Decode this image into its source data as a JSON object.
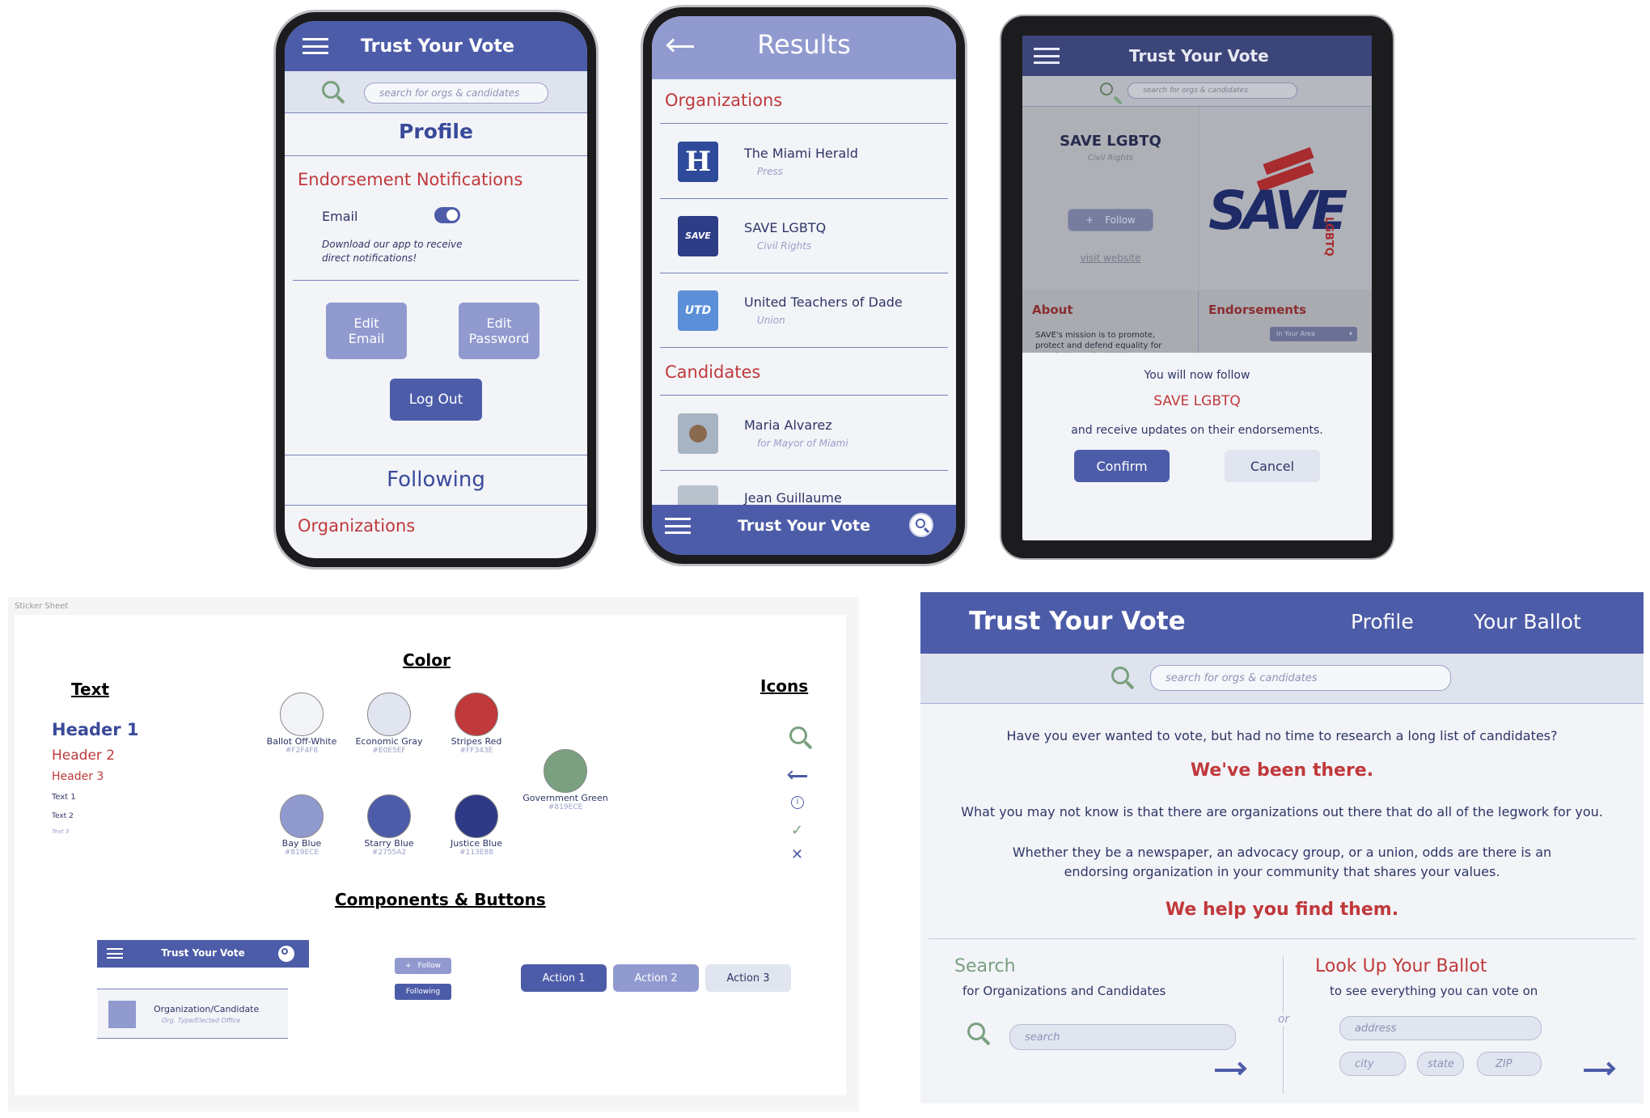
{
  "phone1": {
    "title": "Trust Your Vote",
    "search_placeholder": "search for orgs & candidates",
    "profile_heading": "Profile",
    "notifications_heading": "Endorsement Notifications",
    "email_label": "Email",
    "email_toggle_on": true,
    "download_note": "Download our app to receive direct notifications!",
    "edit_email": "Edit Email",
    "edit_password": "Edit Password",
    "log_out": "Log Out",
    "following_heading": "Following",
    "organizations_heading": "Organizations"
  },
  "phone2": {
    "title": "Results",
    "organizations_heading": "Organizations",
    "organizations": [
      {
        "name": "The Miami Herald",
        "type": "Press",
        "logo_text": "H",
        "logo_color": "#2e4a9a"
      },
      {
        "name": "SAVE LGBTQ",
        "type": "Civil Rights",
        "logo_text": "SAVE",
        "logo_color": "#2d3d86"
      },
      {
        "name": "United Teachers of Dade",
        "type": "Union",
        "logo_text": "UTD",
        "logo_color": "#5b8fd8"
      }
    ],
    "candidates_heading": "Candidates",
    "candidates": [
      {
        "name": "Maria Alvarez",
        "role": "for Mayor of Miami"
      },
      {
        "name": "Jean Guillaume",
        "role": ""
      }
    ],
    "bottom_title": "Trust Your Vote"
  },
  "tablet": {
    "title": "Trust Your Vote",
    "search_placeholder": "search for orgs & candidates",
    "org_name": "SAVE LGBTQ",
    "org_type": "Civil Rights",
    "follow_label": "Follow",
    "visit_website": "visit website",
    "logo_text": "SAVE",
    "logo_side": "LGBTQ",
    "about_heading": "About",
    "about_text": "SAVE's mission is to promote, protect and defend equality for people in South Florida",
    "endorsements_heading": "Endorsements",
    "area_select": "In Your Area",
    "modal_line1": "You will now follow",
    "modal_org": "SAVE LGBTQ",
    "modal_line2": "and receive updates on their endorsements.",
    "confirm": "Confirm",
    "cancel": "Cancel"
  },
  "sticker": {
    "label": "Sticker Sheet",
    "text_heading": "Text",
    "header1": "Header 1",
    "header2": "Header 2",
    "header3": "Header 3",
    "text1": "Text 1",
    "text2": "Text 2",
    "text3": "Text 3",
    "color_heading": "Color",
    "colors": [
      {
        "name": "Ballot Off-White",
        "hex": "#F2F4F8",
        "value": "#F2F4F8"
      },
      {
        "name": "Economic Gray",
        "hex": "#E0E5EF",
        "value": "#E0E5EF"
      },
      {
        "name": "Stripes Red",
        "hex": "#FF343E",
        "value": "#C0393B"
      },
      {
        "name": "Bay Blue",
        "hex": "#819ECE",
        "value": "#919ACF"
      },
      {
        "name": "Starry Blue",
        "hex": "#2755A2",
        "value": "#4D5CA8"
      },
      {
        "name": "Justice Blue",
        "hex": "#113E88",
        "value": "#2F3A86"
      },
      {
        "name": "Government Green",
        "hex": "#819ECE",
        "value": "#7AA07F"
      }
    ],
    "icons_heading": "Icons",
    "components_heading": "Components & Buttons",
    "comp_title": "Trust Your Vote",
    "follow": "Follow",
    "following": "Following",
    "action1": "Action 1",
    "action2": "Action 2",
    "action3": "Action 3",
    "card_title": "Organization/Candidate",
    "card_sub": "Org. Type/Elected Office"
  },
  "desktop": {
    "title": "Trust Your Vote",
    "nav_profile": "Profile",
    "nav_ballot": "Your Ballot",
    "search_placeholder": "search for orgs & candidates",
    "intro_q": "Have you ever wanted to vote, but had no time to research a long list of candidates?",
    "been_there": "We've been there.",
    "p2": "What you may not know is that there are organizations out there that do all of the legwork for you.",
    "p3": "Whether they be a newspaper, an advocacy group, or a union, odds are there is an endorsing organization in your community that shares your values.",
    "help": "We help you find them.",
    "search_heading": "Search",
    "search_sub": "for Organizations and Candidates",
    "search_input": "search",
    "or": "or",
    "ballot_heading": "Look Up Your Ballot",
    "ballot_sub": "to see everything you can vote on",
    "address": "address",
    "city": "city",
    "state": "state",
    "zip": "ZIP"
  }
}
